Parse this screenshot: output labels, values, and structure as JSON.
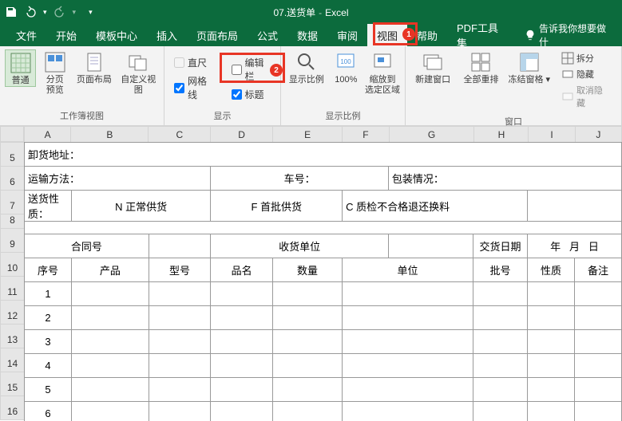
{
  "titlebar": {
    "doc_name": "07.送货单",
    "app_name": "Excel"
  },
  "tabs": {
    "file": "文件",
    "home": "开始",
    "template": "模板中心",
    "insert": "插入",
    "layout": "页面布局",
    "formulas": "公式",
    "data": "数据",
    "review": "审阅",
    "view": "视图",
    "help": "帮助",
    "pdf": "PDF工具集",
    "tell": "告诉我你想要做什"
  },
  "ribbon": {
    "group_views": "工作簿视图",
    "normal": "普通",
    "page_break": "分页\n预览",
    "page_layout": "页面布局",
    "custom_views": "自定义视图",
    "group_show": "显示",
    "ruler": "直尺",
    "formula_bar": "编辑栏",
    "gridlines": "网格线",
    "headings": "标题",
    "group_zoom": "显示比例",
    "zoom": "显示比例",
    "hundred": "100%",
    "zoom_sel": "缩放到\n选定区域",
    "group_window": "窗口",
    "new_window": "新建窗口",
    "arrange": "全部重排",
    "freeze": "冻结窗格",
    "split": "拆分",
    "hide": "隐藏",
    "unhide": "取消隐藏"
  },
  "columns": [
    "A",
    "B",
    "C",
    "D",
    "E",
    "F",
    "G",
    "H",
    "I",
    "J"
  ],
  "rows": [
    "5",
    "6",
    "7",
    "8",
    "9",
    "10",
    "11",
    "12",
    "13",
    "14",
    "15",
    "16"
  ],
  "sheet": {
    "unload_addr_label": "卸货地址：",
    "transport_label": "运输方法：",
    "car_label": "车号：",
    "pack_label": "包装情况：",
    "delivery_nature_label": "送货性质：",
    "n_normal": "N 正常供货",
    "f_first": "F  首批供货",
    "c_reject": "C  质检不合格退还换料",
    "contract_no": "合同号",
    "recv_unit": "收货单位",
    "deliver_date": "交货日期",
    "year": "年",
    "month": "月",
    "day": "日",
    "seq": "序号",
    "product": "产品",
    "model": "型号",
    "name": "品名",
    "qty": "数量",
    "uom": "单位",
    "batch": "批号",
    "nature": "性质",
    "remark": "备注"
  },
  "colors": {
    "brand": "#0c6b3d",
    "highlight": "#e83525"
  },
  "chart_data": {
    "type": "table",
    "columns": [
      "序号",
      "产品",
      "型号",
      "品名",
      "数量",
      "单位",
      "批号",
      "性质",
      "备注"
    ],
    "rows": [
      {
        "序号": 1
      },
      {
        "序号": 2
      },
      {
        "序号": 3
      },
      {
        "序号": 4
      },
      {
        "序号": 5
      },
      {
        "序号": 6
      }
    ]
  }
}
